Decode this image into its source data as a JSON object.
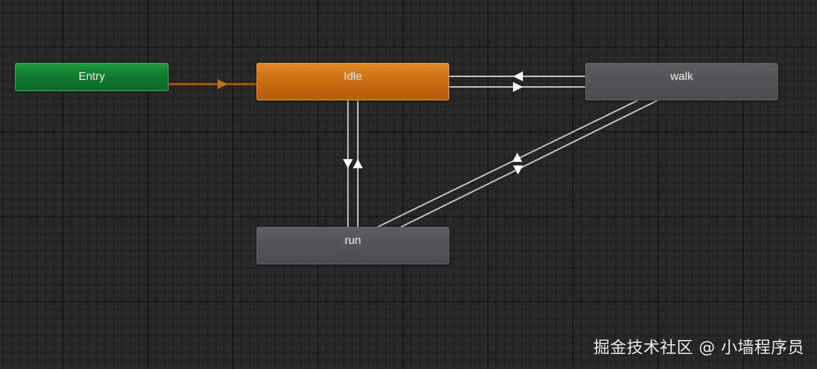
{
  "graph": {
    "states": [
      {
        "id": "entry",
        "label": "Entry",
        "kind": "entry",
        "color": "#0d7a2c"
      },
      {
        "id": "idle",
        "label": "Idle",
        "kind": "default",
        "color": "#c76d12"
      },
      {
        "id": "walk",
        "label": "walk",
        "kind": "normal",
        "color": "#4a4c50"
      },
      {
        "id": "run",
        "label": "run",
        "kind": "normal",
        "color": "#4a4c50"
      }
    ],
    "transitions": [
      {
        "from": "entry",
        "to": "idle"
      },
      {
        "from": "walk",
        "to": "idle"
      },
      {
        "from": "idle",
        "to": "walk"
      },
      {
        "from": "idle",
        "to": "run"
      },
      {
        "from": "run",
        "to": "idle"
      },
      {
        "from": "run",
        "to": "walk"
      },
      {
        "from": "walk",
        "to": "run"
      }
    ],
    "colors": {
      "background": "#282828",
      "transition_line": "#c8c8c8",
      "entry_transition": "#b86a10",
      "arrow": "#ffffff"
    }
  },
  "watermark": {
    "text": "掘金技术社区 @ 小墙程序员"
  }
}
